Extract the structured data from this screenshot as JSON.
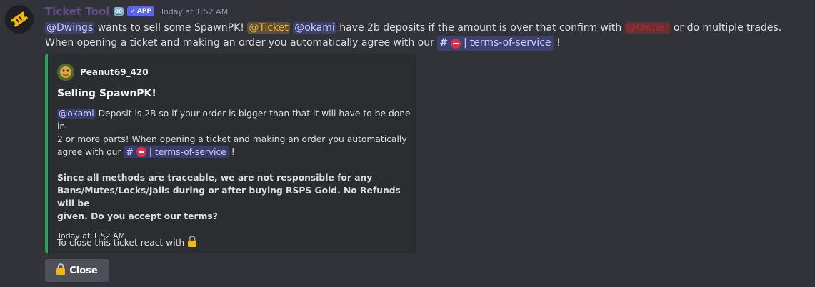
{
  "message": {
    "author": "Ticket Tool",
    "app_badge": "APP",
    "timestamp": "Today at 1:52 AM",
    "line1": {
      "mention_dwings": "@Dwings",
      "t1": " wants to sell some SpawnPK! ",
      "mention_ticket": "@Ticket",
      "t2": " ",
      "mention_okami": "@okami",
      "t3": " have 2b deposits if the amount is over that confirm with ",
      "mention_owner": "@Owner",
      "t4": " or do multiple trades."
    },
    "line2": {
      "t1": "When opening a ticket and making an order you automatically agree with our ",
      "channel_hash": "#",
      "channel_sep": "|",
      "channel_name": "terms-of-service",
      "t2": " !"
    }
  },
  "embed": {
    "author": "Peanut69_420",
    "title": "Selling SpawnPK!",
    "desc": {
      "mention": "@okami",
      "t1": " Deposit is 2B so if your order is bigger than that it will have to be done in",
      "t2": "2 or more parts! When opening a ticket and making an order you automatically",
      "t3": "agree with our ",
      "channel_hash": "#",
      "channel_sep": "|",
      "channel_name": "terms-of-service",
      "t4": " !",
      "bold1": "Since all methods are traceable, we are not responsible for any",
      "bold2": "Bans/Mutes/Locks/Jails during or after buying RSPS Gold. No Refunds will be",
      "bold3": "given. Do you accept our terms?",
      "close_text": "To close this ticket react with "
    },
    "footer": "Today at 1:52 AM",
    "accent_color": "#23a55a"
  },
  "button": {
    "label": "Close",
    "icon": "lock-icon"
  }
}
